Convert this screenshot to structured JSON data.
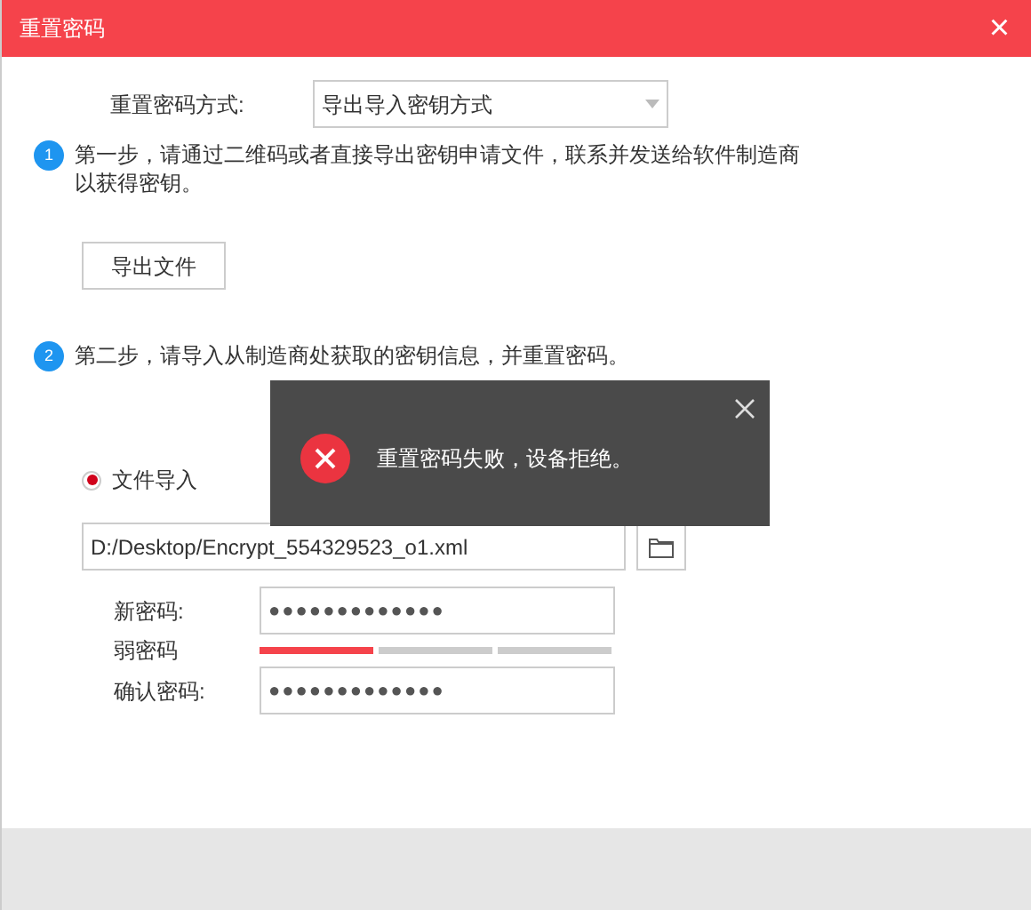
{
  "window": {
    "title": "重置密码",
    "close": "×"
  },
  "method": {
    "label": "重置密码方式:",
    "value": "导出导入密钥方式"
  },
  "steps": [
    {
      "number": "1",
      "text": "第一步，请通过二维码或者直接导出密钥申请文件，联系并发送给软件制造商以获得密钥。"
    },
    {
      "number": "2",
      "text": "第二步，请导入从制造商处获取的密钥信息，并重置密码。"
    }
  ],
  "export_button": "导出文件",
  "import_option": {
    "label": "文件导入",
    "selected": true
  },
  "file_path": {
    "value": "D:/Desktop/Encrypt_554329523_o1.xml"
  },
  "new_password": {
    "label": "新密码:",
    "value": "●●●●●●●●●●●●●"
  },
  "strength": {
    "label": "弱密码",
    "segments": [
      {
        "on": true
      },
      {
        "on": false
      },
      {
        "on": false
      }
    ]
  },
  "confirm_password": {
    "label": "确认密码:",
    "value": "●●●●●●●●●●●●●"
  },
  "toast": {
    "message": "重置密码失败，设备拒绝。"
  }
}
